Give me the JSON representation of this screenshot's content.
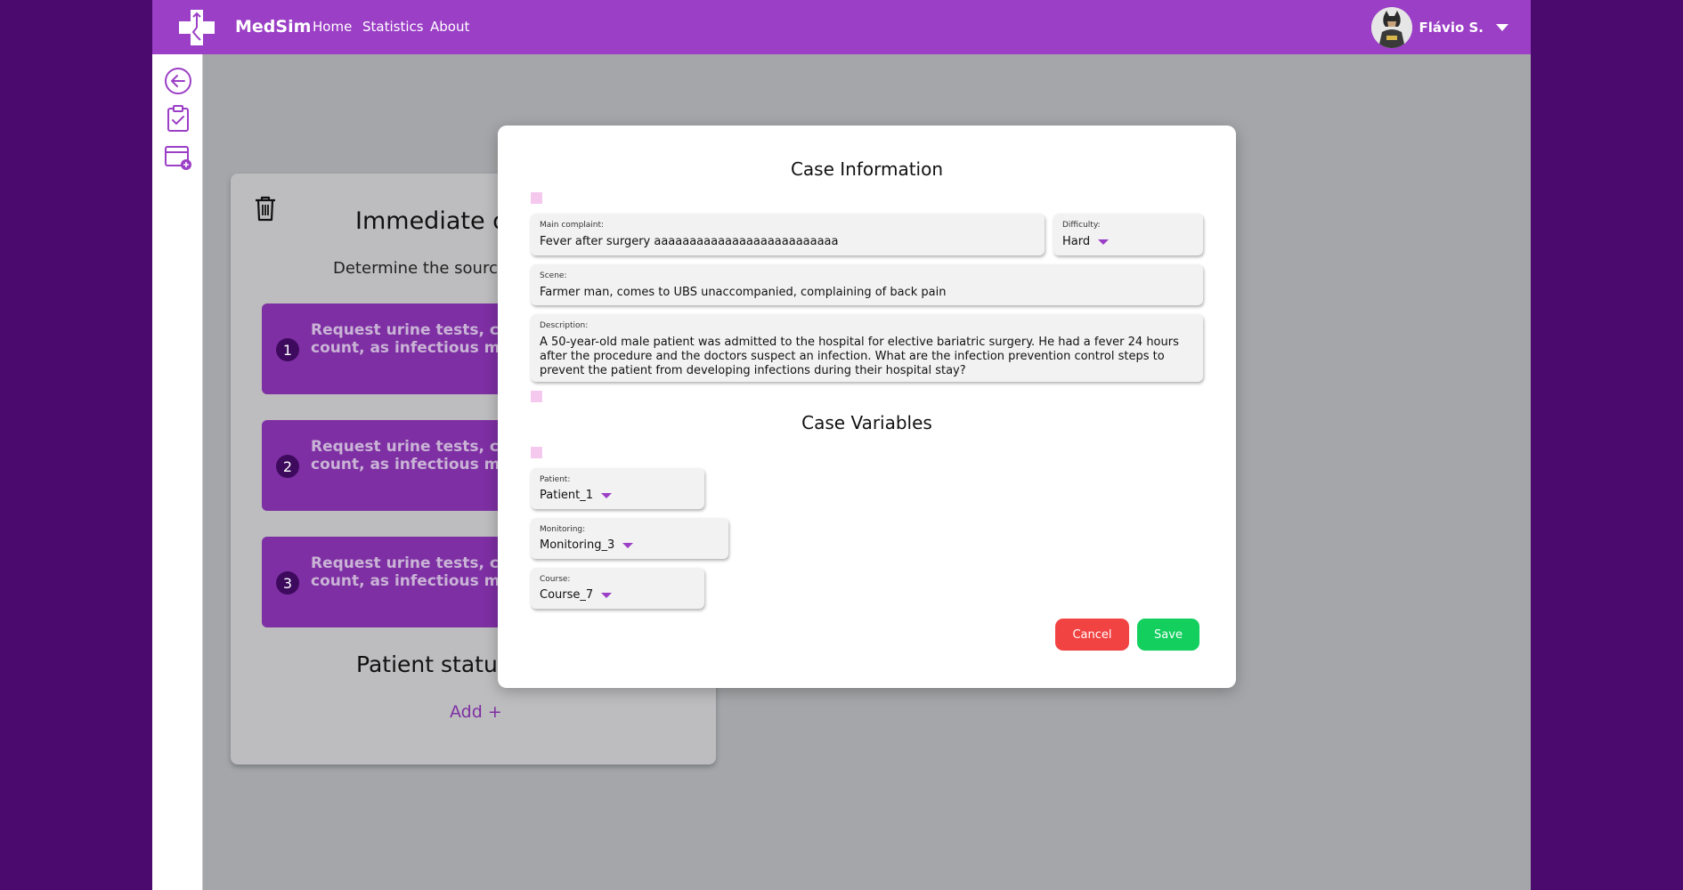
{
  "header": {
    "brand": "MedSim",
    "nav": [
      "Home",
      "Statistics",
      "About"
    ],
    "user_name": "Flávio S."
  },
  "sidebar": {
    "icons": [
      "back-arrow-icon",
      "clipboard-check-icon",
      "add-window-icon"
    ]
  },
  "background_card": {
    "title": "Immediate c",
    "subtitle": "Determine the sourc",
    "steps": [
      {
        "number": "1",
        "text": "Request urine tests, chest complete blood count, as infectious markers"
      },
      {
        "number": "2",
        "text": "Request urine tests, chest complete blood count, as infectious markers"
      },
      {
        "number": "3",
        "text": "Request urine tests, chest complete blood count, as infectious markers"
      }
    ],
    "status_heading": "Patient statu",
    "add_label": "Add +"
  },
  "modal": {
    "case_info_title": "Case Information",
    "main_complaint": {
      "label": "Main complaint:",
      "value": "Fever after surgery aaaaaaaaaaaaaaaaaaaaaaaaaa"
    },
    "difficulty": {
      "label": "Difficulty:",
      "value": "Hard"
    },
    "scene": {
      "label": "Scene:",
      "value": "Farmer man, comes to UBS unaccompanied, complaining of back pain"
    },
    "description": {
      "label": "Description:",
      "value": "A 50-year-old male patient was admitted to the hospital for elective bariatric surgery. He had a fever 24 hours after the procedure and the doctors suspect an infection. What are the infection prevention control steps to prevent the patient from developing infections during their hospital stay?"
    },
    "case_variables_title": "Case Variables",
    "patient": {
      "label": "Patient:",
      "value": "Patient_1"
    },
    "monitoring": {
      "label": "Monitoring:",
      "value": "Monitoring_3"
    },
    "course": {
      "label": "Course:",
      "value": "Course_7"
    },
    "cancel_label": "Cancel",
    "save_label": "Save"
  },
  "colors": {
    "brand_purple": "#9b3fc6",
    "outer_background": "#4a0a6e",
    "cancel_red": "#f24343",
    "save_green": "#12cf5e"
  }
}
